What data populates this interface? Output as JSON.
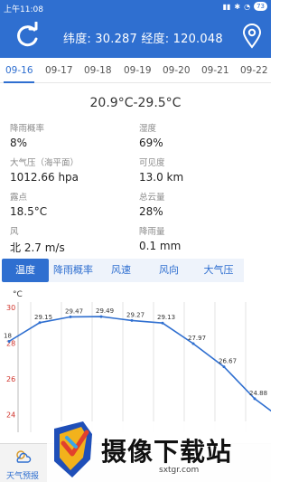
{
  "status_bar": {
    "time": "上午11:08",
    "battery": "73"
  },
  "header": {
    "coords": "纬度: 30.287 经度: 120.048"
  },
  "dates": [
    "09-16",
    "09-17",
    "09-18",
    "09-19",
    "09-20",
    "09-21",
    "09-22"
  ],
  "active_date": "09-16",
  "temp_range": "20.9°C-29.5°C",
  "metrics": [
    {
      "label": "降雨概率",
      "value": "8%"
    },
    {
      "label": "湿度",
      "value": "69%"
    },
    {
      "label": "大气压（海平面）",
      "value": "1012.66 hpa"
    },
    {
      "label": "可见度",
      "value": "13.0 km"
    },
    {
      "label": "露点",
      "value": "18.5°C"
    },
    {
      "label": "总云量",
      "value": "28%"
    },
    {
      "label": "风",
      "value": "北 2.7 m/s"
    },
    {
      "label": "降雨量",
      "value": "0.1 mm"
    }
  ],
  "chart_tabs": [
    "温度",
    "降雨概率",
    "风速",
    "风向",
    "大气压"
  ],
  "active_chart_tab": "温度",
  "chart_data": {
    "type": "line",
    "ylabel": "°C",
    "ylim": [
      23,
      30
    ],
    "yticks": [
      24,
      26,
      28,
      30
    ],
    "series": [
      {
        "values": [
          28.1,
          29.15,
          29.47,
          29.49,
          29.27,
          29.13,
          27.97,
          26.67,
          24.88,
          23.6
        ]
      }
    ],
    "labels": [
      "18",
      "29.15",
      "29.47",
      "29.49",
      "29.27",
      "29.13",
      "27.97",
      "26.67",
      "24.88",
      ""
    ]
  },
  "bottom_nav": {
    "label": "天气预报"
  },
  "watermark": {
    "text": "摄像下载站",
    "sub": "sxtgr.com"
  },
  "colors": {
    "primary": "#2f6fd0",
    "axis_label": "#d0342c"
  }
}
